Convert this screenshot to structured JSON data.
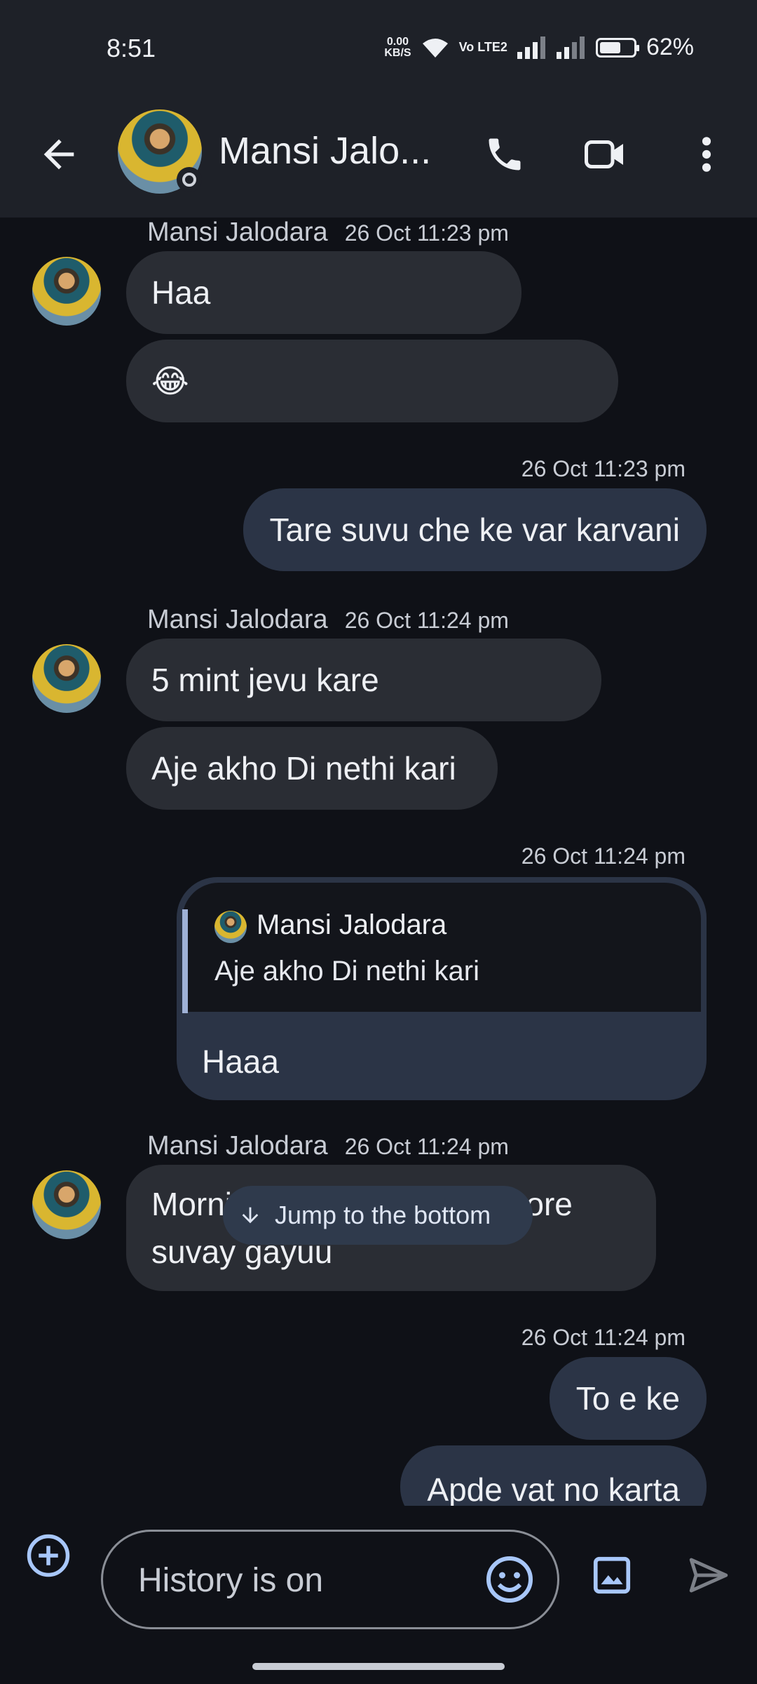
{
  "status_bar": {
    "time": "8:51",
    "network_speed": "0.00",
    "network_unit": "KB/S",
    "volte": "Vo LTE2",
    "battery_percent": "62%",
    "battery_level": 0.62
  },
  "header": {
    "contact_name": "Mansi Jalo...",
    "icons": [
      "back-arrow-icon",
      "phone-icon",
      "video-icon",
      "more-vert-icon"
    ]
  },
  "messages": [
    {
      "type": "in-header",
      "sender": "Mansi Jalodara",
      "time": "26 Oct 11:23 pm"
    },
    {
      "type": "in",
      "text": "Haa"
    },
    {
      "type": "in",
      "text": "😂"
    },
    {
      "type": "out-time",
      "time": "26 Oct 11:23 pm"
    },
    {
      "type": "out",
      "text": "Tare suvu che ke var karvani"
    },
    {
      "type": "in-header",
      "sender": "Mansi Jalodara",
      "time": "26 Oct 11:24 pm"
    },
    {
      "type": "in",
      "text": "5 mint jevu kare"
    },
    {
      "type": "in",
      "text": "Aje akho Di nethi kari"
    },
    {
      "type": "out-time",
      "time": "26 Oct 11:24 pm"
    },
    {
      "type": "reply",
      "quoted_sender": "Mansi Jalodara",
      "quoted_text": "Aje akho Di nethi kari",
      "text": "Haaa"
    },
    {
      "type": "in-header",
      "sender": "Mansi Jalodara",
      "time": "26 Oct 11:24 pm"
    },
    {
      "type": "in",
      "text": "Morning ma kam hatu bapore suvay gayuu"
    },
    {
      "type": "out-time",
      "time": "26 Oct 11:24 pm"
    },
    {
      "type": "out",
      "text": "To e ke"
    },
    {
      "type": "out",
      "text": "Apde vat no karta"
    }
  ],
  "jump_button": {
    "label": "Jump to the bottom"
  },
  "composer": {
    "placeholder": "History is on"
  },
  "colors": {
    "background": "#0f1117",
    "bar": "#1e2128",
    "incoming_bubble": "#2a2d34",
    "outgoing_bubble": "#2b3446",
    "accent": "#a8c7fa"
  }
}
